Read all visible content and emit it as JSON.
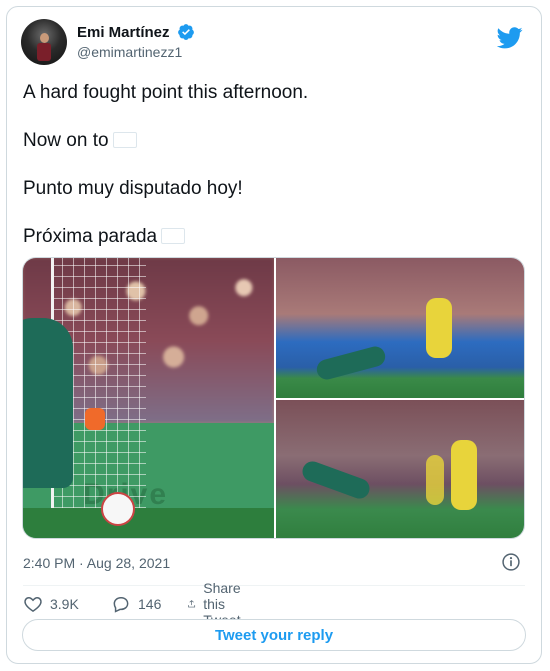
{
  "tweet": {
    "author": {
      "display_name": "Emi Martínez",
      "handle": "@emimartinezz1",
      "verified": true
    },
    "text_lines": [
      "A hard fought point this afternoon.",
      "Now on to",
      "Punto muy disputado hoy!",
      "Próxima parada"
    ],
    "flag_emoji": "argentina-flag",
    "media": {
      "image_count": 3,
      "left_board_text": "Drive"
    },
    "timestamp": "2:40 PM · Aug 28, 2021",
    "likes": "3.9K",
    "replies": "146",
    "share_label": "Share this Tweet",
    "reply_button_label": "Tweet your reply"
  },
  "colors": {
    "brand_blue": "#1d9bf0",
    "secondary_text": "#536471",
    "border": "#cfd9de"
  },
  "icons": {
    "brand": "twitter-bird-icon",
    "verified": "verified-badge-icon",
    "info": "info-icon",
    "like": "heart-icon",
    "reply": "speech-bubble-icon",
    "share": "share-upload-icon"
  }
}
